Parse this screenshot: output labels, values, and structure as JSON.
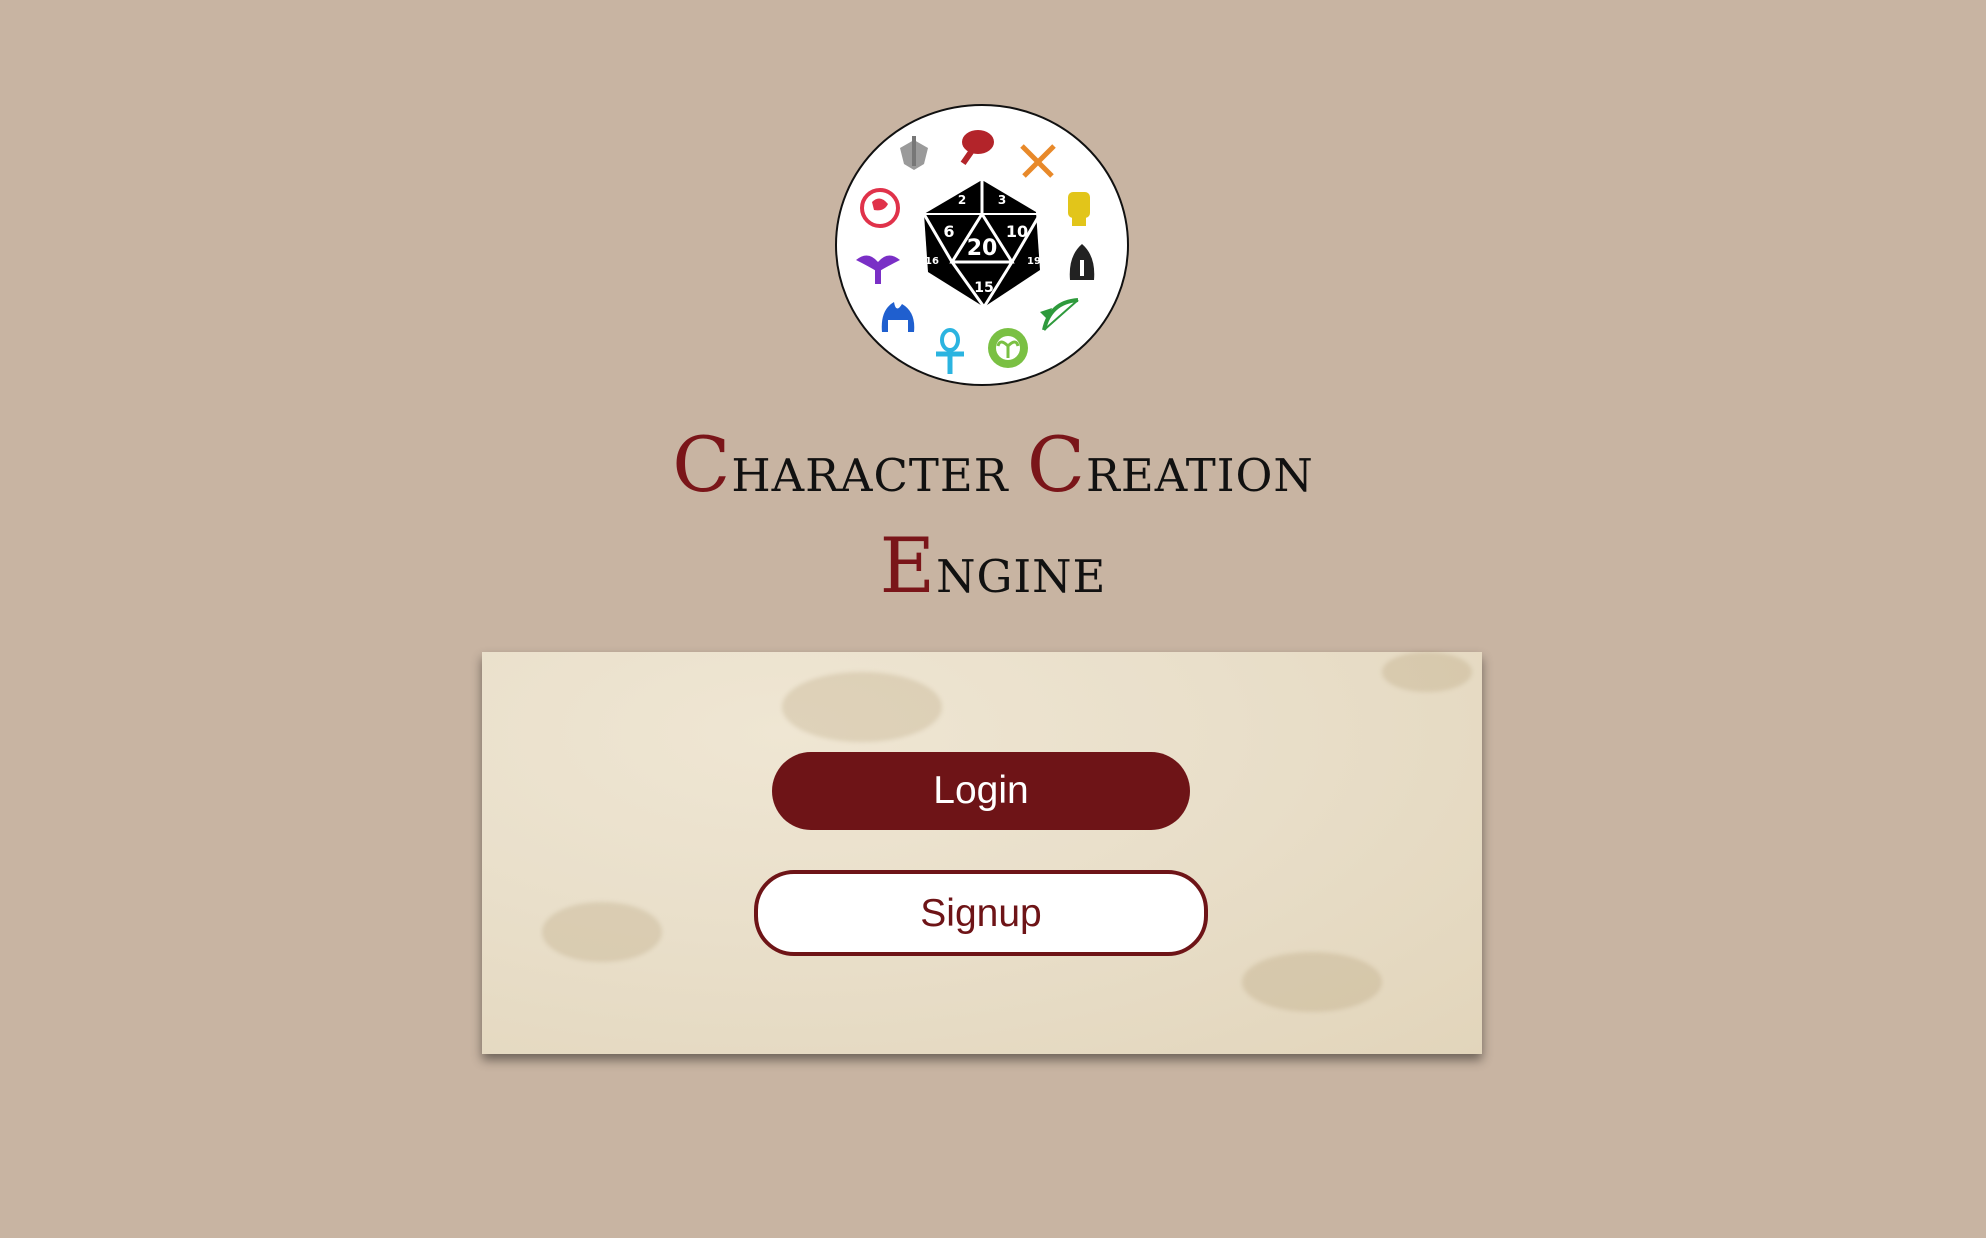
{
  "title": {
    "line1_word1_initial": "C",
    "line1_word1_rest": "haracter",
    "line1_word2_initial": "C",
    "line1_word2_rest": "reation",
    "line2_initial": "E",
    "line2_rest": "ngine"
  },
  "logo": {
    "die_faces": [
      "2",
      "3",
      "6",
      "10",
      "20",
      "15",
      "16",
      "19"
    ],
    "class_icons": [
      "paladin-icon",
      "barbarian-icon",
      "fighter-icon",
      "monk-icon",
      "rogue-icon",
      "ranger-icon",
      "druid-icon",
      "cleric-icon",
      "wizard-icon",
      "warlock-icon",
      "sorcerer-icon"
    ]
  },
  "auth": {
    "login_label": "Login",
    "signup_label": "Signup"
  },
  "colors": {
    "background": "#c8b4a2",
    "accent": "#6e1417",
    "panel": "#e9dfca"
  }
}
